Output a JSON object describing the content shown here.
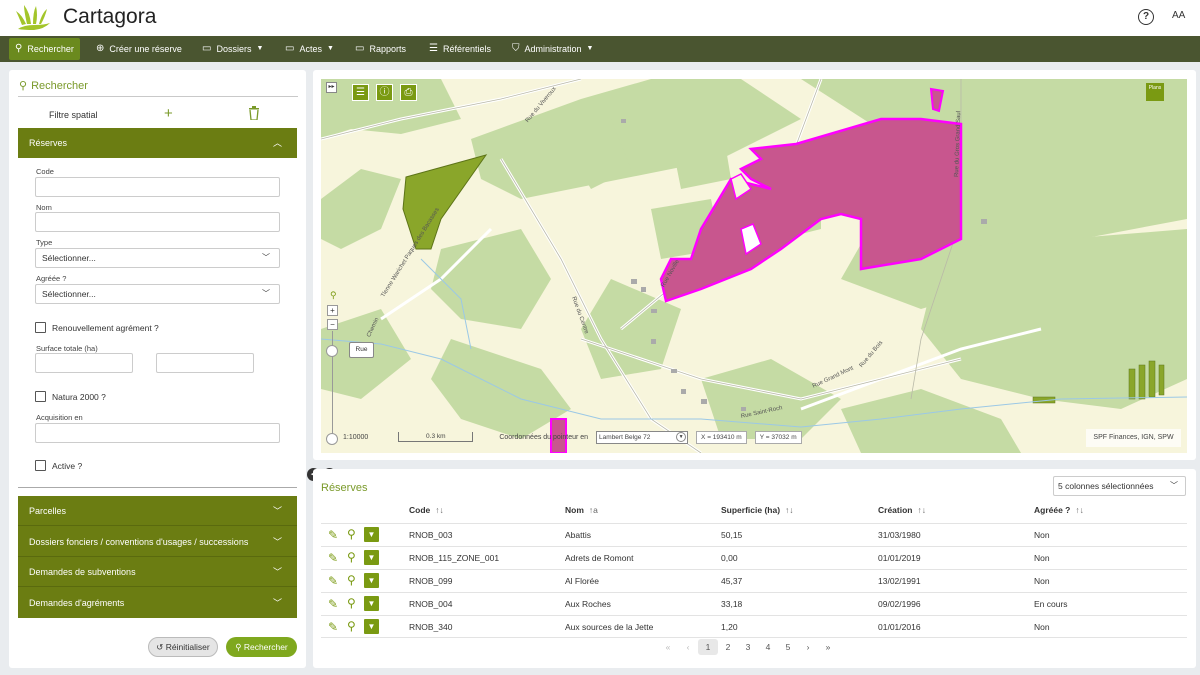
{
  "app": {
    "title": "Cartagora",
    "avatar": "AA",
    "help_icon": "?"
  },
  "nav": [
    {
      "label": "Rechercher",
      "icon": "search-icon",
      "active": true
    },
    {
      "label": "Créer une réserve",
      "icon": "plus-circle-icon"
    },
    {
      "label": "Dossiers",
      "icon": "folder-icon",
      "dropdown": true
    },
    {
      "label": "Actes",
      "icon": "folder-icon",
      "dropdown": true
    },
    {
      "label": "Rapports",
      "icon": "folder-icon"
    },
    {
      "label": "Référentiels",
      "icon": "list-icon"
    },
    {
      "label": "Administration",
      "icon": "shield-icon",
      "dropdown": true
    }
  ],
  "search": {
    "title": "Rechercher",
    "spatial_filter": "Filtre spatial",
    "reserves_section": "Réserves",
    "code_label": "Code",
    "nom_label": "Nom",
    "type_label": "Type",
    "type_value": "Sélectionner...",
    "agreee_label": "Agréée ?",
    "agreee_value": "Sélectionner...",
    "renouvellement_label": "Renouvellement agrément ?",
    "surface_label": "Surface totale (ha)",
    "natura_label": "Natura 2000 ?",
    "acquisition_label": "Acquisition en",
    "active_label": "Active ?",
    "sections": [
      "Parcelles",
      "Dossiers fonciers / conventions d'usages / successions",
      "Demandes de subventions",
      "Demandes d'agréments"
    ],
    "reset_button": "Réinitialiser",
    "search_button": "Rechercher"
  },
  "map": {
    "plans_label": "Plans",
    "scale": "1:10000",
    "scale_bar": "0.3 km",
    "pointer_label": "Coordonnées du pointeur en",
    "projection": "Lambert Belge 72",
    "x_coord": "X = 193410 m",
    "y_coord": "Y = 37032 m",
    "attribution": "SPF Finances, IGN, SPW",
    "tooltip": "Rue",
    "road_labels": [
      "Rue du Viveroux",
      "Tienne Warichet Paques des Bacasses",
      "Rue du Centre",
      "Rue Noville",
      "Rue Saint-Roch",
      "Rue Grand Mont",
      "Rue du Bois",
      "Chemin",
      "Rue du Gros Grand Saul"
    ],
    "colors": {
      "reserve_fill": "#c8568e",
      "reserve_stroke": "#ff00ff",
      "forest": "#c5dba4",
      "background": "#f7f5dc"
    }
  },
  "table": {
    "title": "Réserves",
    "columns_select": "5 colonnes sélectionnées",
    "headers": [
      "Code",
      "Nom",
      "Superficie (ha)",
      "Création",
      "Agréée ?"
    ],
    "rows": [
      {
        "code": "RNOB_003",
        "nom": "Abattis",
        "superficie": "50,15",
        "creation": "31/03/1980",
        "agreee": "Non"
      },
      {
        "code": "RNOB_115_ZONE_001",
        "nom": "Adrets de Romont",
        "superficie": "0,00",
        "creation": "01/01/2019",
        "agreee": "Non"
      },
      {
        "code": "RNOB_099",
        "nom": "Al Florée",
        "superficie": "45,37",
        "creation": "13/02/1991",
        "agreee": "Non"
      },
      {
        "code": "RNOB_004",
        "nom": "Aux Roches",
        "superficie": "33,18",
        "creation": "09/02/1996",
        "agreee": "En cours"
      },
      {
        "code": "RNOB_340",
        "nom": "Aux sources de la Jette",
        "superficie": "1,20",
        "creation": "01/01/2016",
        "agreee": "Non"
      }
    ],
    "pager": [
      "«",
      "‹",
      "1",
      "2",
      "3",
      "4",
      "5",
      "›",
      "»"
    ],
    "current_page": "1"
  }
}
